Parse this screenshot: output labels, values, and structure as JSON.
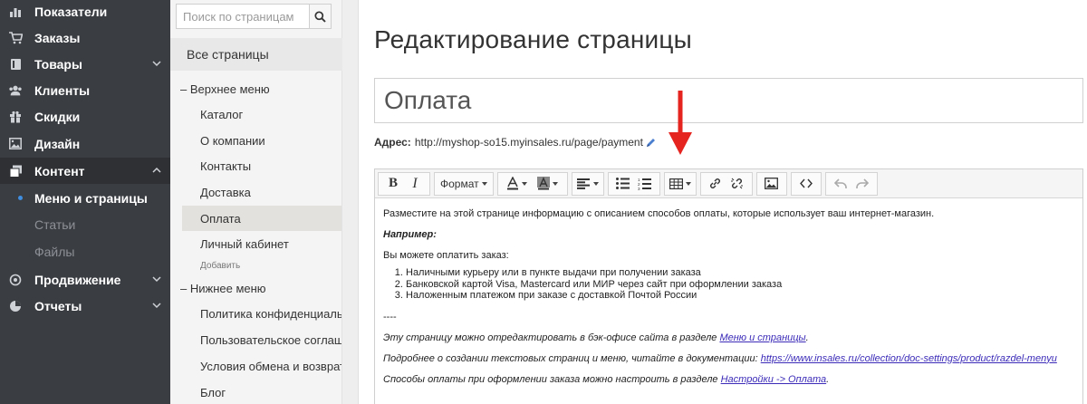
{
  "sidebar": {
    "items": [
      {
        "label": "Показатели",
        "icon": "chart-bars-icon",
        "expandable": false
      },
      {
        "label": "Заказы",
        "icon": "cart-icon",
        "expandable": false
      },
      {
        "label": "Товары",
        "icon": "book-icon",
        "expandable": true
      },
      {
        "label": "Клиенты",
        "icon": "users-icon",
        "expandable": false
      },
      {
        "label": "Скидки",
        "icon": "gift-icon",
        "expandable": false
      },
      {
        "label": "Дизайн",
        "icon": "image-icon",
        "expandable": false
      },
      {
        "label": "Контент",
        "icon": "copy-icon",
        "expandable": true,
        "expanded": true
      },
      {
        "label": "Продвижение",
        "icon": "target-icon",
        "expandable": true
      },
      {
        "label": "Отчеты",
        "icon": "pie-chart-icon",
        "expandable": true
      }
    ],
    "content_sub": [
      {
        "label": "Меню и страницы",
        "current": true
      },
      {
        "label": "Статьи",
        "current": false
      },
      {
        "label": "Файлы",
        "current": false
      }
    ]
  },
  "pages_panel": {
    "search_placeholder": "Поиск по страницам",
    "all_pages": "Все страницы",
    "groups": [
      {
        "label": "– Верхнее меню",
        "pages": [
          "Каталог",
          "О компании",
          "Контакты",
          "Доставка",
          "Оплата",
          "Личный кабинет"
        ],
        "selected": "Оплата",
        "add_label": "Добавить"
      },
      {
        "label": "– Нижнее меню",
        "pages": [
          "Политика конфиденциальности",
          "Пользовательское соглашение",
          "Условия обмена и возврата",
          "Блог"
        ]
      }
    ]
  },
  "main": {
    "heading": "Редактирование страницы",
    "title_value": "Оплата",
    "address_label": "Адрес:",
    "address_url": "http://myshop-so15.myinsales.ru/page/payment",
    "toolbar": {
      "format_label": "Формат"
    },
    "content": {
      "intro": "Разместите на этой странице информацию с описанием способов оплаты, которые использует ваш интернет-магазин.",
      "example_label": "Например:",
      "pay_label": "Вы можете оплатить заказ:",
      "list": [
        "Наличными курьеру или в пункте выдачи при получении заказа",
        "Банковской картой Visa, Mastercard или МИР через сайт при оформлении заказа",
        "Наложенным платежом при заказе с доставкой Почтой России"
      ],
      "separator": "----",
      "edit_note_text": "Эту страницу можно отредактировать в бэк-офисе сайта в разделе ",
      "edit_note_link": "Меню и страницы",
      "edit_note_end": ".",
      "docs_text": "Подробнее о создании текстовых страниц и меню, читайте в документации: ",
      "docs_link": "https://www.insales.ru/collection/doc-settings/product/razdel-menyu",
      "settings_text": "Способы оплаты при оформлении заказа можно настроить в разделе ",
      "settings_link": "Настройки -> Оплата",
      "settings_end": "."
    }
  },
  "colors": {
    "sidebar_bg": "#3a3d42",
    "active_dot": "#3f8ee0",
    "arrow": "#e52420",
    "link": "#3b2bb8"
  }
}
